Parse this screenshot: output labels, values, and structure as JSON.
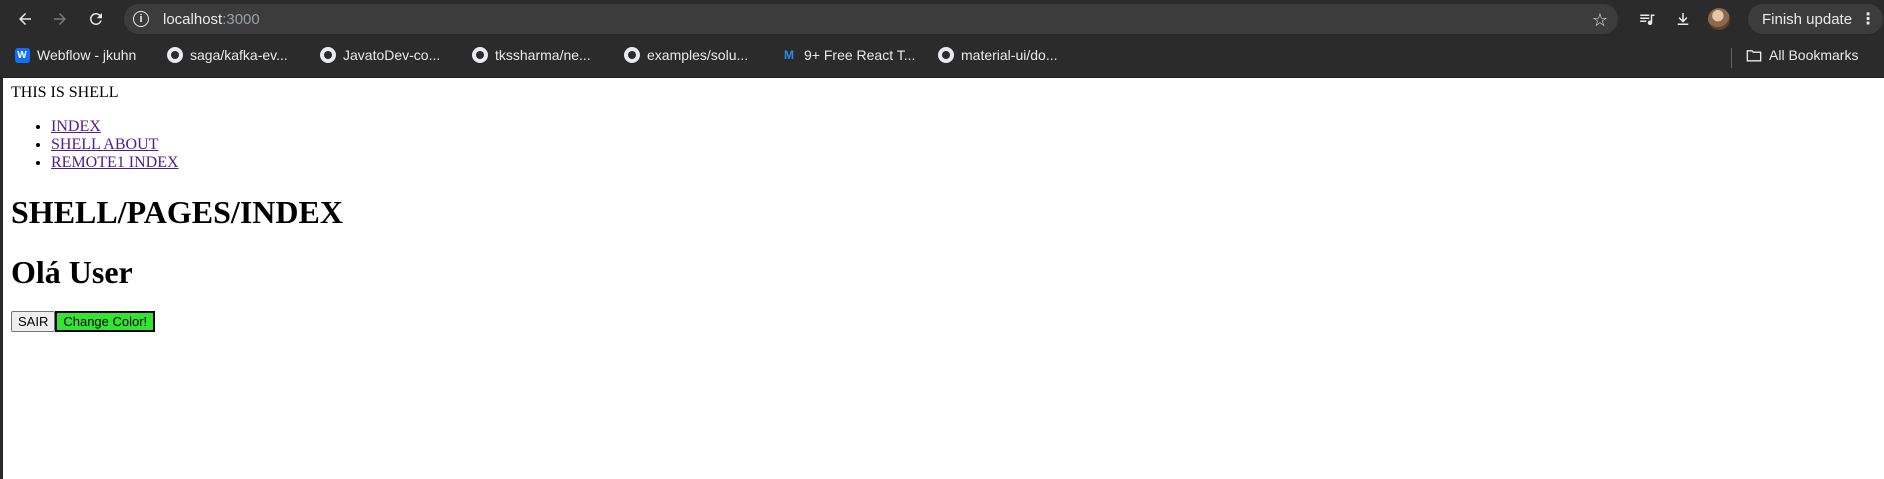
{
  "browser": {
    "url_host": "localhost",
    "url_port": ":3000",
    "finish_update_label": "Finish update"
  },
  "bookmarks": [
    {
      "label": "Webflow - jkuhn",
      "icon": "webflow-icon"
    },
    {
      "label": "saga/kafka-ev...",
      "icon": "github-icon"
    },
    {
      "label": "JavatoDev-co...",
      "icon": "github-icon"
    },
    {
      "label": "tkssharma/ne...",
      "icon": "github-icon"
    },
    {
      "label": "examples/solu...",
      "icon": "github-icon"
    },
    {
      "label": "9+ Free React T...",
      "icon": "mui-icon"
    },
    {
      "label": "material-ui/do...",
      "icon": "github-icon"
    }
  ],
  "all_bookmarks_label": "All Bookmarks",
  "page": {
    "shell_title": "THIS IS SHELL",
    "nav": [
      {
        "label": "INDEX"
      },
      {
        "label": "SHELL ABOUT"
      },
      {
        "label": "REMOTE1 INDEX"
      }
    ],
    "heading": "SHELL/PAGES/INDEX",
    "greeting": "Olá User",
    "buttons": {
      "sair": "SAIR",
      "change_color": "Change Color!"
    }
  },
  "colors": {
    "change_color_button_bg": "#31e531",
    "visited_link": "#551a8b",
    "chrome_bg": "#2b2b2b"
  }
}
